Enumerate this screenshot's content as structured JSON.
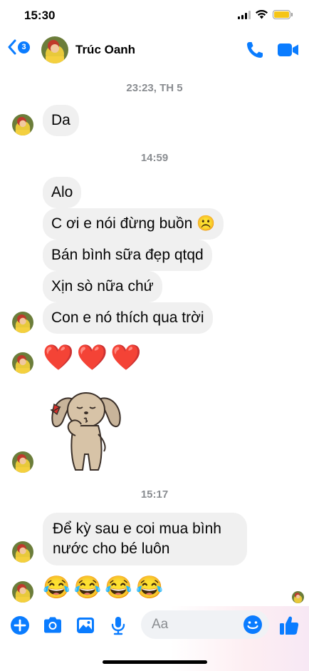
{
  "status_bar": {
    "time": "15:30"
  },
  "header": {
    "back_count": "3",
    "contact_name": "Trúc Oanh",
    "call_icon": "phone-icon",
    "video_icon": "video-camera-icon"
  },
  "conversation": {
    "timestamp_1": "23:23, TH 5",
    "msg_da": "Da",
    "timestamp_2": "14:59",
    "msg_alo": "Alo",
    "msg_2": "C ơi e nói đừng buồn ☹️",
    "msg_3": "Bán bình sữa đẹp qtqd",
    "msg_4": "Xịn sò nữa chứ",
    "msg_5": "Con e nó thích qua trời",
    "hearts": "❤️❤️❤️",
    "sticker": "puppy-blowing-kiss-sticker",
    "timestamp_3": "15:17",
    "msg_6": "Để kỳ sau e coi mua bình nước cho bé luôn",
    "laughs": "😂😂😂😂"
  },
  "composer": {
    "placeholder": "Aa",
    "icons": [
      "plus-icon",
      "camera-icon",
      "image-icon",
      "microphone-icon",
      "emoji-icon",
      "thumbs-up-icon"
    ]
  },
  "colors": {
    "accent": "#0a7cff",
    "bubble": "#f0f0f0",
    "timestamp": "#8a8d91"
  }
}
